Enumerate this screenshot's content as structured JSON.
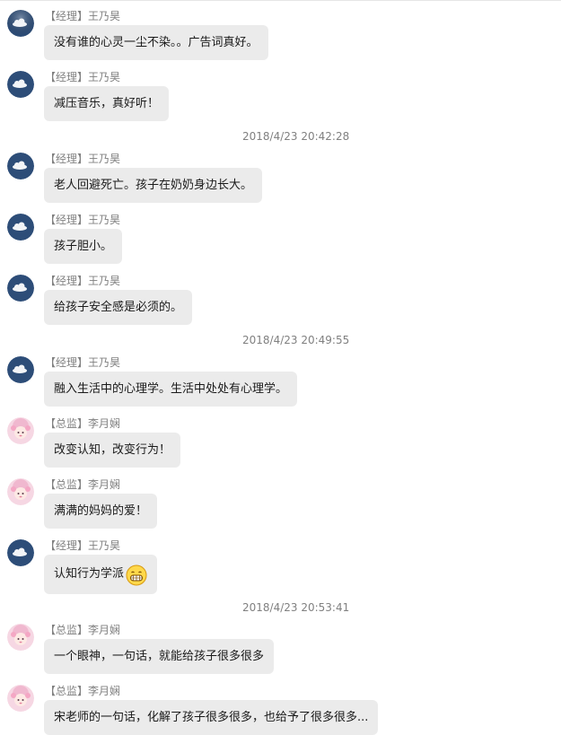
{
  "messages": [
    {
      "sender": "【经理】王乃昊",
      "avatar": "cloud-avatar",
      "text": "没有谁的心灵一尘不染。。广告词真好。"
    },
    {
      "sender": "【经理】王乃昊",
      "avatar": "cloud-avatar",
      "text": "减压音乐，真好听！"
    },
    {
      "timestamp": "2018/4/23 20:42:28"
    },
    {
      "sender": "【经理】王乃昊",
      "avatar": "cloud-avatar",
      "text": "老人回避死亡。孩子在奶奶身边长大。"
    },
    {
      "sender": "【经理】王乃昊",
      "avatar": "cloud-avatar",
      "text": "孩子胆小。"
    },
    {
      "sender": "【经理】王乃昊",
      "avatar": "cloud-avatar",
      "text": "给孩子安全感是必须的。"
    },
    {
      "timestamp": "2018/4/23 20:49:55"
    },
    {
      "sender": "【经理】王乃昊",
      "avatar": "cloud-avatar",
      "text": "融入生活中的心理学。生活中处处有心理学。"
    },
    {
      "sender": "【总监】李月娴",
      "avatar": "pink-girl-avatar",
      "text": "改变认知，改变行为！"
    },
    {
      "sender": "【总监】李月娴",
      "avatar": "pink-girl-avatar",
      "text": "满满的妈妈的爱！"
    },
    {
      "sender": "【经理】王乃昊",
      "avatar": "cloud-avatar",
      "text": "认知行为学派",
      "emoji": "grin-emoji"
    },
    {
      "timestamp": "2018/4/23 20:53:41"
    },
    {
      "sender": "【总监】李月娴",
      "avatar": "pink-girl-avatar",
      "text": "一个眼神，一句话，就能给孩子很多很多"
    },
    {
      "sender": "【总监】李月娴",
      "avatar": "pink-girl-avatar",
      "text": "宋老师的一句话，化解了孩子很多很多，也给予了很多很多..."
    }
  ]
}
